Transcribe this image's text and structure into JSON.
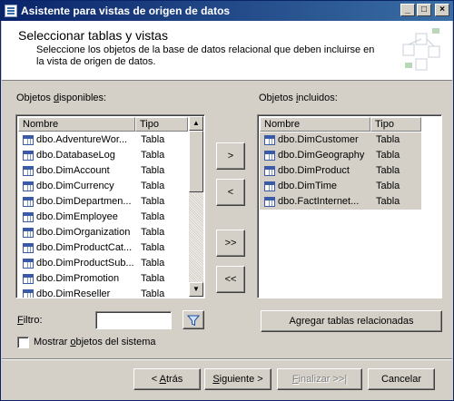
{
  "window": {
    "title": "Asistente para vistas de origen de datos",
    "minimize": "_",
    "maximize": "□",
    "close": "×"
  },
  "header": {
    "title": "Seleccionar tablas y vistas",
    "description": "Seleccione los objetos de la base de datos relacional que deben incluirse en la vista de origen de datos."
  },
  "available": {
    "label_pre": "Objetos ",
    "label_u": "d",
    "label_post": "isponibles:",
    "col_name": "Nombre",
    "col_type": "Tipo",
    "rows": [
      {
        "name": "dbo.AdventureWor...",
        "type": "Tabla"
      },
      {
        "name": "dbo.DatabaseLog",
        "type": "Tabla"
      },
      {
        "name": "dbo.DimAccount",
        "type": "Tabla"
      },
      {
        "name": "dbo.DimCurrency",
        "type": "Tabla"
      },
      {
        "name": "dbo.DimDepartmen...",
        "type": "Tabla"
      },
      {
        "name": "dbo.DimEmployee",
        "type": "Tabla"
      },
      {
        "name": "dbo.DimOrganization",
        "type": "Tabla"
      },
      {
        "name": "dbo.DimProductCat...",
        "type": "Tabla"
      },
      {
        "name": "dbo.DimProductSub...",
        "type": "Tabla"
      },
      {
        "name": "dbo.DimPromotion",
        "type": "Tabla"
      },
      {
        "name": "dbo.DimReseller",
        "type": "Tabla"
      }
    ]
  },
  "included": {
    "label_pre": "Objetos ",
    "label_u": "i",
    "label_post": "ncluidos:",
    "col_name": "Nombre",
    "col_type": "Tipo",
    "rows": [
      {
        "name": "dbo.DimCustomer",
        "type": "Tabla"
      },
      {
        "name": "dbo.DimGeography",
        "type": "Tabla"
      },
      {
        "name": "dbo.DimProduct",
        "type": "Tabla"
      },
      {
        "name": "dbo.DimTime",
        "type": "Tabla"
      },
      {
        "name": "dbo.FactInternet...",
        "type": "Tabla"
      }
    ]
  },
  "transfer": {
    "add_one": ">",
    "remove_one": "<",
    "add_all": ">>",
    "remove_all": "<<"
  },
  "filter": {
    "label_pre": "",
    "label_u": "F",
    "label_post": "iltro:",
    "value": ""
  },
  "add_related_label": "Agregar tablas relacionadas",
  "show_system": {
    "label_pre": "Mostrar ",
    "label_u": "o",
    "label_post": "bjetos del sistema",
    "checked": false
  },
  "footer": {
    "back_pre": "< ",
    "back_u": "A",
    "back_post": "trás",
    "next_pre": "",
    "next_u": "S",
    "next_post": "iguiente >",
    "finish_pre": "",
    "finish_u": "F",
    "finish_post": "inalizar >>|",
    "cancel": "Cancelar"
  }
}
